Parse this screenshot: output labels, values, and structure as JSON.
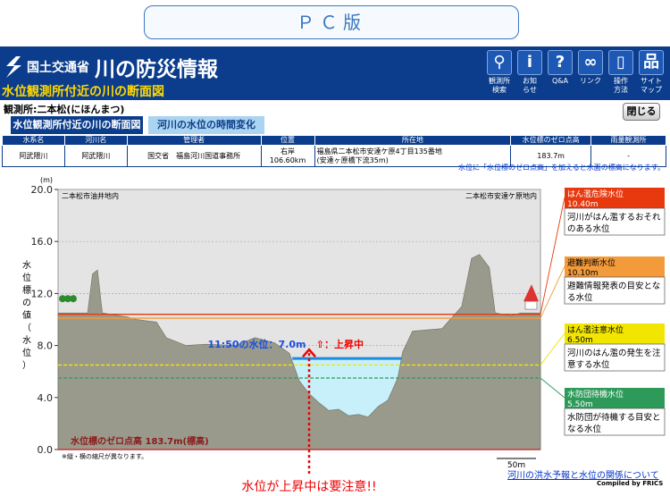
{
  "pc_button": "ＰＣ版",
  "header": {
    "ministry": "国土交通省",
    "title": "川の防災情報",
    "subtitle": "水位観測所付近の川の断面図",
    "nav": [
      {
        "glyph": "⚲",
        "label": "観測所\n検索"
      },
      {
        "glyph": "i",
        "label": "お知\nらせ"
      },
      {
        "glyph": "?",
        "label": "Q&A"
      },
      {
        "glyph": "∞",
        "label": "リンク"
      },
      {
        "glyph": "▯",
        "label": "操作\n方法"
      },
      {
        "glyph": "品",
        "label": "サイト\nマップ"
      }
    ]
  },
  "station_label": "観測所:二本松(にほんまつ)",
  "close_button": "閉じる",
  "tabs": [
    "水位観測所付近の川の断面図",
    "河川の水位の時間変化"
  ],
  "table": {
    "headers": [
      "水系名",
      "河川名",
      "管理者",
      "位置",
      "所在地",
      "水位標のゼロ点高",
      "雨量観測所"
    ],
    "row": [
      "阿武隈川",
      "阿武隈川",
      "国交省　福島河川国道事務所",
      "右岸106.60km",
      "福島県二本松市安達ケ原4丁目135番地\n(安達ヶ原橋下流35m)",
      "183.7m",
      "-"
    ]
  },
  "note": "水位に「水位標のゼロ点高」を加えると水面の標高になります。",
  "chart_data": {
    "type": "area",
    "ylabel": "水位標の値（水位）",
    "yunit": "(m)",
    "ylim": [
      0,
      20
    ],
    "yticks": [
      "0.0",
      "4.0",
      "8.0",
      "12.0",
      "16.0",
      "20.0"
    ],
    "left_place": "二本松市油井地内",
    "right_place": "二本松市安達ケ原地内",
    "current_time_label": "11:50の水位：7.0m",
    "current_level": 7.0,
    "trend_label": "⇧：上昇中",
    "zero_point_label": "水位標のゼロ点高 183.7m(標高)",
    "scale_note": "※縦・横の縮尺が異なります。",
    "scale_bar": "50m",
    "warning_text": "水位が上昇中は要注意!!",
    "thresholds": [
      {
        "name": "はん濫危険水位",
        "value_label": "10.40m",
        "value": 10.4,
        "desc": "河川がはん濫するおそれのある水位",
        "color": "#e8380d"
      },
      {
        "name": "避難判断水位",
        "value_label": "10.10m",
        "value": 10.1,
        "desc": "避難情報発表の目安となる水位",
        "color": "#f39a3a"
      },
      {
        "name": "はん濫注意水位",
        "value_label": "6.50m",
        "value": 6.5,
        "desc": "河川のはん濫の発生を注意する水位",
        "color": "#f2e600"
      },
      {
        "name": "水防団待機水位",
        "value_label": "5.50m",
        "value": 5.5,
        "desc": "水防団が待機する目安となる水位",
        "color": "#2e9a5a"
      }
    ],
    "ground_profile": [
      [
        0,
        10.5
      ],
      [
        30,
        10.5
      ],
      [
        35,
        13.5
      ],
      [
        40,
        13.8
      ],
      [
        45,
        10.5
      ],
      [
        70,
        10.2
      ],
      [
        80,
        10.0
      ],
      [
        100,
        9.8
      ],
      [
        110,
        8.6
      ],
      [
        130,
        8.0
      ],
      [
        150,
        8.1
      ],
      [
        180,
        8.0
      ],
      [
        200,
        8.6
      ],
      [
        220,
        8.2
      ],
      [
        235,
        7.4
      ],
      [
        245,
        5.3
      ],
      [
        255,
        4.3
      ],
      [
        265,
        3.6
      ],
      [
        275,
        3.0
      ],
      [
        285,
        3.1
      ],
      [
        295,
        2.6
      ],
      [
        305,
        2.7
      ],
      [
        315,
        2.5
      ],
      [
        325,
        3.3
      ],
      [
        335,
        3.8
      ],
      [
        345,
        5.5
      ],
      [
        350,
        7.5
      ],
      [
        360,
        9.1
      ],
      [
        390,
        9.3
      ],
      [
        410,
        11.0
      ],
      [
        420,
        14.7
      ],
      [
        428,
        15.0
      ],
      [
        438,
        14.0
      ],
      [
        444,
        10.5
      ],
      [
        460,
        10.3
      ],
      [
        470,
        10.5
      ],
      [
        490,
        10.5
      ]
    ]
  },
  "footer": {
    "link": "河川の洪水予報と水位の関係について",
    "compiled": "Compiled by FRICS"
  }
}
